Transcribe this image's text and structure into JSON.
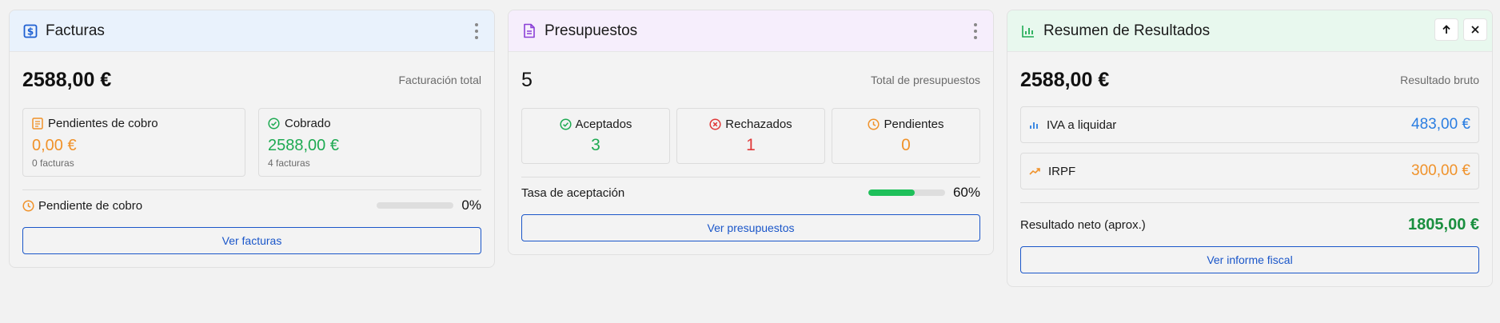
{
  "colors": {
    "orange": "#f0922a",
    "green": "#1eaa52",
    "dark_green": "#1a8f3f",
    "red": "#e03a3a",
    "blue": "#2a7de1",
    "button_blue": "#1a56c9",
    "facturas_header_bg": "#e9f2fc",
    "presupuestos_header_bg": "#f6eefc",
    "resumen_header_bg": "#e8f8ee"
  },
  "facturas": {
    "title": "Facturas",
    "icon": "dollar-document-icon",
    "total": "2588,00 €",
    "total_label": "Facturación total",
    "pending": {
      "label": "Pendientes de cobro",
      "amount": "0,00 €",
      "note": "0 facturas",
      "icon": "receipt-icon"
    },
    "collected": {
      "label": "Cobrado",
      "amount": "2588,00 €",
      "note": "4 facturas",
      "icon": "check-circle-icon"
    },
    "progress": {
      "label": "Pendiente de cobro",
      "percent_text": "0%",
      "value": 0
    },
    "button": "Ver facturas"
  },
  "presupuestos": {
    "title": "Presupuestos",
    "icon": "document-icon",
    "total": "5",
    "total_label": "Total de presupuestos",
    "accepted": {
      "label": "Aceptados",
      "value": "3",
      "icon": "check-circle-icon"
    },
    "rejected": {
      "label": "Rechazados",
      "value": "1",
      "icon": "x-circle-icon"
    },
    "pending": {
      "label": "Pendientes",
      "value": "0",
      "icon": "clock-icon"
    },
    "progress": {
      "label": "Tasa de aceptación",
      "percent_text": "60%",
      "value": 60
    },
    "button": "Ver presupuestos"
  },
  "resumen": {
    "title": "Resumen de Resultados",
    "icon": "bar-chart-icon",
    "total": "2588,00 €",
    "total_label": "Resultado bruto",
    "iva": {
      "label": "IVA a liquidar",
      "amount": "483,00 €",
      "icon": "bar-chart-icon"
    },
    "irpf": {
      "label": "IRPF",
      "amount": "300,00 €",
      "icon": "trending-up-icon"
    },
    "net": {
      "label": "Resultado neto (aprox.)",
      "amount": "1805,00 €"
    },
    "button": "Ver informe fiscal",
    "controls": [
      "arrow-up-icon",
      "close-icon"
    ]
  }
}
